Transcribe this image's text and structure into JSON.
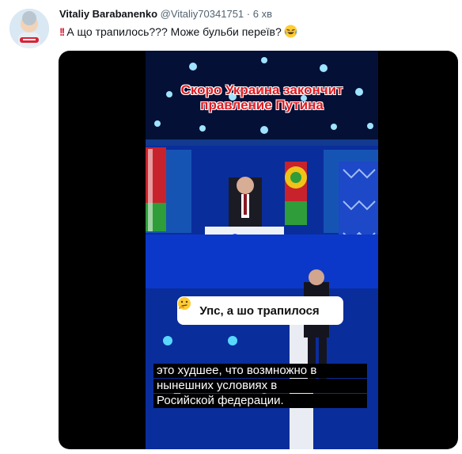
{
  "author": {
    "name": "Vitaliy Barabanenko",
    "handle": "@Vitaliy70341751",
    "separator": "·",
    "time": "6 хв"
  },
  "tweet": {
    "text": "А що трапилось??? Може бульби переїв?",
    "emoji_icon": "laughing-tears-emoji"
  },
  "video": {
    "caption_top": "Скоро Украина закончит правление Путина",
    "bubble_text": "Упс, а шо трапилося",
    "bubble_emoji_icon": "thinking-face-emoji",
    "caption_bottom": [
      "это худшее, что возмножно в",
      "нынешних условиях в",
      "Росийской федерации."
    ]
  },
  "colors": {
    "name": "#0f1419",
    "secondary": "#536471",
    "caption_red": "#e11b22",
    "stage_blue": "#0a3fd0"
  }
}
